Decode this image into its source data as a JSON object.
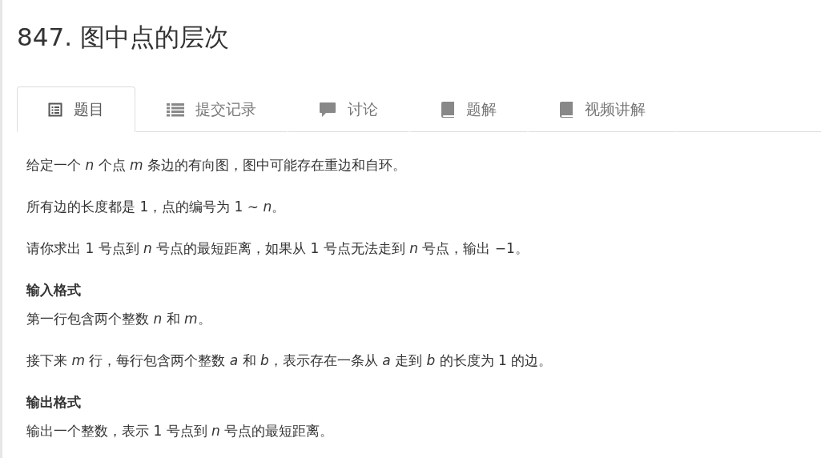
{
  "title": "847. 图中点的层次",
  "tabs": [
    {
      "label": "题目",
      "kind": "document",
      "selected": true
    },
    {
      "label": "提交记录",
      "kind": "list",
      "selected": false
    },
    {
      "label": "讨论",
      "kind": "comment",
      "selected": false
    },
    {
      "label": "题解",
      "kind": "book",
      "selected": false
    },
    {
      "label": "视频讲解",
      "kind": "book",
      "selected": false
    }
  ],
  "content": [
    {
      "kind": "paragraph",
      "text": "给定一个 *n* 个点 *m* 条边的有向图，图中可能存在重边和自环。"
    },
    {
      "kind": "paragraph",
      "text": "所有边的长度都是 1，点的编号为 1 ∼ *n*。"
    },
    {
      "kind": "paragraph",
      "text": "请你求出 1 号点到 *n* 号点的最短距离，如果从 1 号点无法走到 *n* 号点，输出 −1。"
    },
    {
      "kind": "heading",
      "text": "输入格式"
    },
    {
      "kind": "paragraph",
      "text": "第一行包含两个整数 *n* 和 *m*。"
    },
    {
      "kind": "paragraph",
      "text": "接下来 *m* 行，每行包含两个整数 *a* 和 *b*，表示存在一条从 *a* 走到 *b* 的长度为 1 的边。"
    },
    {
      "kind": "heading",
      "text": "输出格式"
    },
    {
      "kind": "paragraph",
      "text": "输出一个整数，表示 1 号点到 *n* 号点的最短距离。"
    }
  ]
}
